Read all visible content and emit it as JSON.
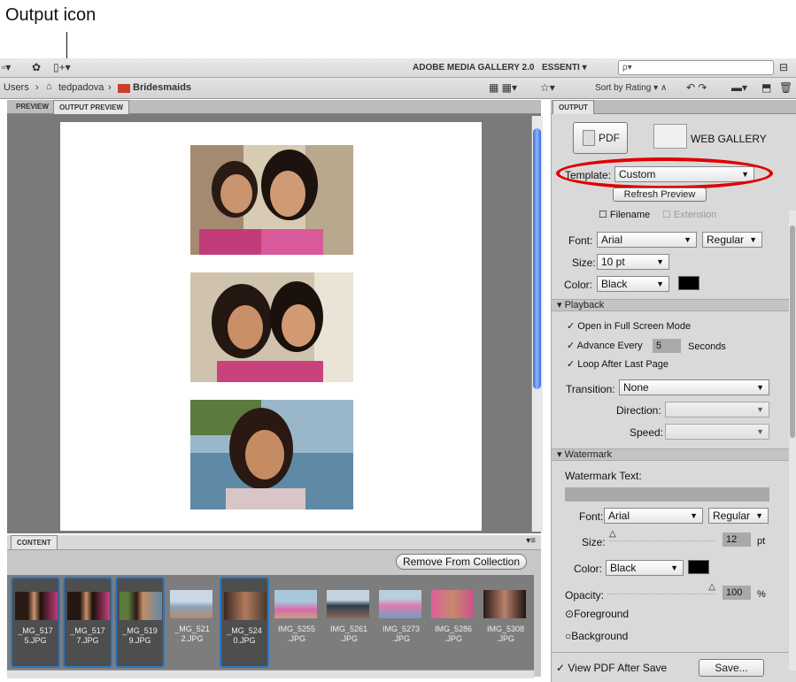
{
  "callout": {
    "label": "Output icon"
  },
  "toolbar": {
    "app_name": "ADOBE MEDIA GALLERY 2.0",
    "workspace": "ESSENTI",
    "search_placeholder": "ρ▾"
  },
  "path": {
    "crumbs": [
      "Users",
      "tedpadova",
      "Bridesmaids"
    ],
    "sort": "Sort by Rating"
  },
  "left_tabs": [
    "PREVIEW",
    "OUTPUT PREVIEW"
  ],
  "content": {
    "tab": "CONTENT",
    "remove_button": "Remove From Collection",
    "thumbnails": [
      {
        "line1": "_MG_517",
        "line2": "5.JPG",
        "selected": true
      },
      {
        "line1": "_MG_517",
        "line2": "7.JPG",
        "selected": true
      },
      {
        "line1": "_MG_519",
        "line2": "9.JPG",
        "selected": true
      },
      {
        "line1": "_MG_521",
        "line2": "2.JPG",
        "selected": false
      },
      {
        "line1": "_MG_524",
        "line2": "0.JPG",
        "selected": true
      },
      {
        "line1": "IMG_5255",
        "line2": ".JPG",
        "selected": false
      },
      {
        "line1": "IMG_5261",
        "line2": ".JPG",
        "selected": false
      },
      {
        "line1": "IMG_5273",
        "line2": ".JPG",
        "selected": false
      },
      {
        "line1": "IMG_5286",
        "line2": ".JPG",
        "selected": false
      },
      {
        "line1": "IMG_5308",
        "line2": ".JPG",
        "selected": false
      }
    ]
  },
  "output": {
    "tab": "OUTPUT",
    "pdf_button": "PDF",
    "web_button": "WEB GALLERY",
    "template_label": "Template:",
    "template_value": "Custom",
    "refresh_button": "Refresh Preview",
    "filename_label": "Filename",
    "extension_label": "Extension",
    "font_label": "Font:",
    "font_value": "Arial",
    "font_style": "Regular",
    "size_label": "Size:",
    "size_value": "10 pt",
    "color_label": "Color:",
    "color_value": "Black"
  },
  "playback": {
    "title": "Playback",
    "full_screen": "Open in Full Screen Mode",
    "advance": "Advance Every",
    "advance_value": "5",
    "seconds": "Seconds",
    "loop": "Loop After Last Page",
    "transition_label": "Transition:",
    "transition_value": "None",
    "direction_label": "Direction:",
    "speed_label": "Speed:"
  },
  "watermark": {
    "title": "Watermark",
    "text_label": "Watermark Text:",
    "font_label": "Font:",
    "font_value": "Arial",
    "font_style": "Regular",
    "size_label": "Size:",
    "size_value": "12",
    "size_unit": "pt",
    "color_label": "Color:",
    "color_value": "Black",
    "opacity_label": "Opacity:",
    "opacity_value": "100",
    "opacity_unit": "%",
    "foreground": "Foreground",
    "background": "Background"
  },
  "footer": {
    "view_pdf": "View PDF After Save",
    "save_button": "Save..."
  },
  "colors": {
    "accent": "#2a78c8",
    "ring": "#e10000",
    "swatch": "#000000"
  }
}
